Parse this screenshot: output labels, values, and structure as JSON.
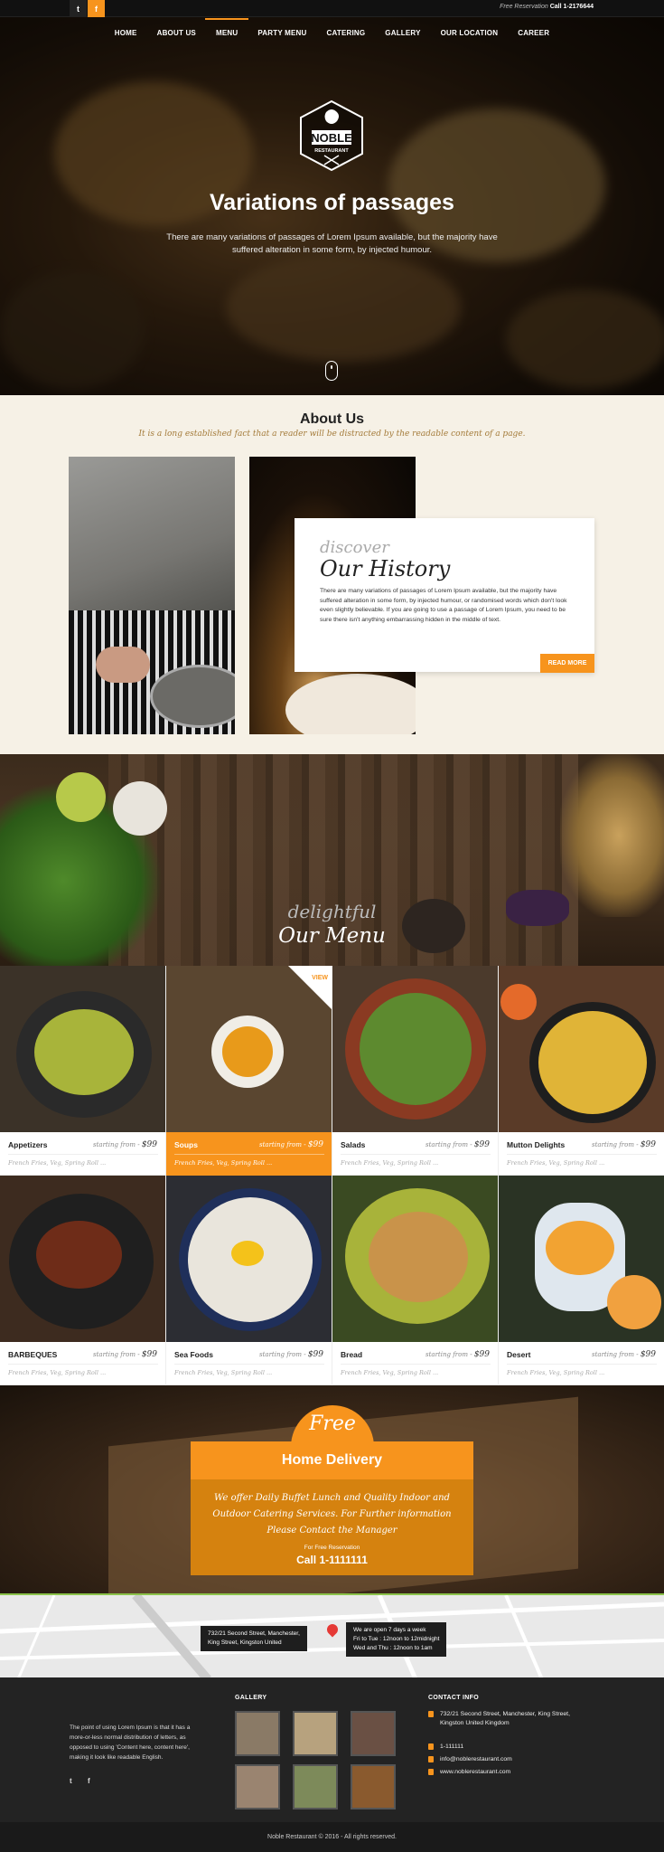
{
  "topbar": {
    "twitter_glyph": "t",
    "facebook_glyph": "f",
    "free_reservation": "Free Reservation",
    "call": "Call 1-2176644"
  },
  "nav": {
    "items": [
      "HOME",
      "ABOUT US",
      "MENU",
      "PARTY MENU",
      "CATERING",
      "GALLERY",
      "OUR LOCATION",
      "CAREER"
    ],
    "active": "MENU"
  },
  "logo": {
    "name": "NOBLE",
    "sub": "RESTAURANT"
  },
  "hero": {
    "title": "Variations of passages",
    "text": "There are many variations of passages of Lorem Ipsum available, but the majority have suffered alteration in some form, by injected humour."
  },
  "about": {
    "title": "About Us",
    "tagline": "It is a long established fact that a reader will be distracted by the readable content of a page.",
    "discover": "discover",
    "history_title": "Our History",
    "history_text": "There are many variations of passages of Lorem Ipsum available, but the majority have suffered alteration in some form, by injected humour, or randomised words which don't look even slightly believable. If you are going to use a passage of Lorem Ipsum, you need to be sure there isn't anything embarrassing hidden in the middle of text.",
    "read_more": "READ MORE"
  },
  "menu_section": {
    "delightful": "delightful",
    "title": "Our Menu",
    "view": "VIEW"
  },
  "menu_items": [
    {
      "name": "Appetizers",
      "starting": "starting from -",
      "price": "$99",
      "desc": "French Fries, Veg, Spring Roll ...",
      "active": false
    },
    {
      "name": "Soups",
      "starting": "starting from -",
      "price": "$99",
      "desc": "French Fries, Veg, Spring Roll ...",
      "active": true
    },
    {
      "name": "Salads",
      "starting": "starting from -",
      "price": "$99",
      "desc": "French Fries, Veg, Spring Roll ...",
      "active": false
    },
    {
      "name": "Mutton Delights",
      "starting": "starting from -",
      "price": "$99",
      "desc": "French Fries, Veg, Spring Roll ...",
      "active": false
    },
    {
      "name": "BARBEQUES",
      "starting": "starting from -",
      "price": "$99",
      "desc": "French Fries, Veg, Spring Roll ...",
      "active": false
    },
    {
      "name": "Sea Foods",
      "starting": "starting from -",
      "price": "$99",
      "desc": "French Fries, Veg, Spring Roll ...",
      "active": false
    },
    {
      "name": "Bread",
      "starting": "starting from -",
      "price": "$99",
      "desc": "French Fries, Veg, Spring Roll ...",
      "active": false
    },
    {
      "name": "Desert",
      "starting": "starting from -",
      "price": "$99",
      "desc": "French Fries, Veg, Spring Roll ...",
      "active": false
    }
  ],
  "delivery": {
    "free": "Free",
    "title": "Home Delivery",
    "text": "We offer Daily Buffet Lunch and Quality Indoor and Outdoor Catering Services. For Further information Please Contact the Manager",
    "free_reservation": "For Free Reservation",
    "call": "Call 1-1111111"
  },
  "map": {
    "address_line1": "732/21 Second Street, Manchester,",
    "address_line2": "King Street, Kingston United",
    "hours_line1": "We are open 7 days a week",
    "hours_line2": "Fri to Tue : 12noon to 12midnight",
    "hours_line3": "Wed and Thu : 12noon to 1am"
  },
  "footer": {
    "about_text": "The point of using Lorem Ipsum is that it has a more-or-less normal distribution of letters, as opposed to using 'Content here, content here', making it look like readable English.",
    "twitter_glyph": "t",
    "facebook_glyph": "f",
    "gallery_title": "GALLERY",
    "contact_title": "CONTACT INFO",
    "address": "732/21 Second Street, Manchester, King Street, Kingston United Kingdom",
    "phone": "1-111111",
    "email": "info@noblerestaurant.com",
    "web": "www.noblerestaurant.com",
    "copyright": "Noble Restaurant © 2016 - All rights reserved."
  },
  "colors": {
    "accent": "#f7941d",
    "dark": "#232323",
    "cream": "#f6f1e6"
  }
}
